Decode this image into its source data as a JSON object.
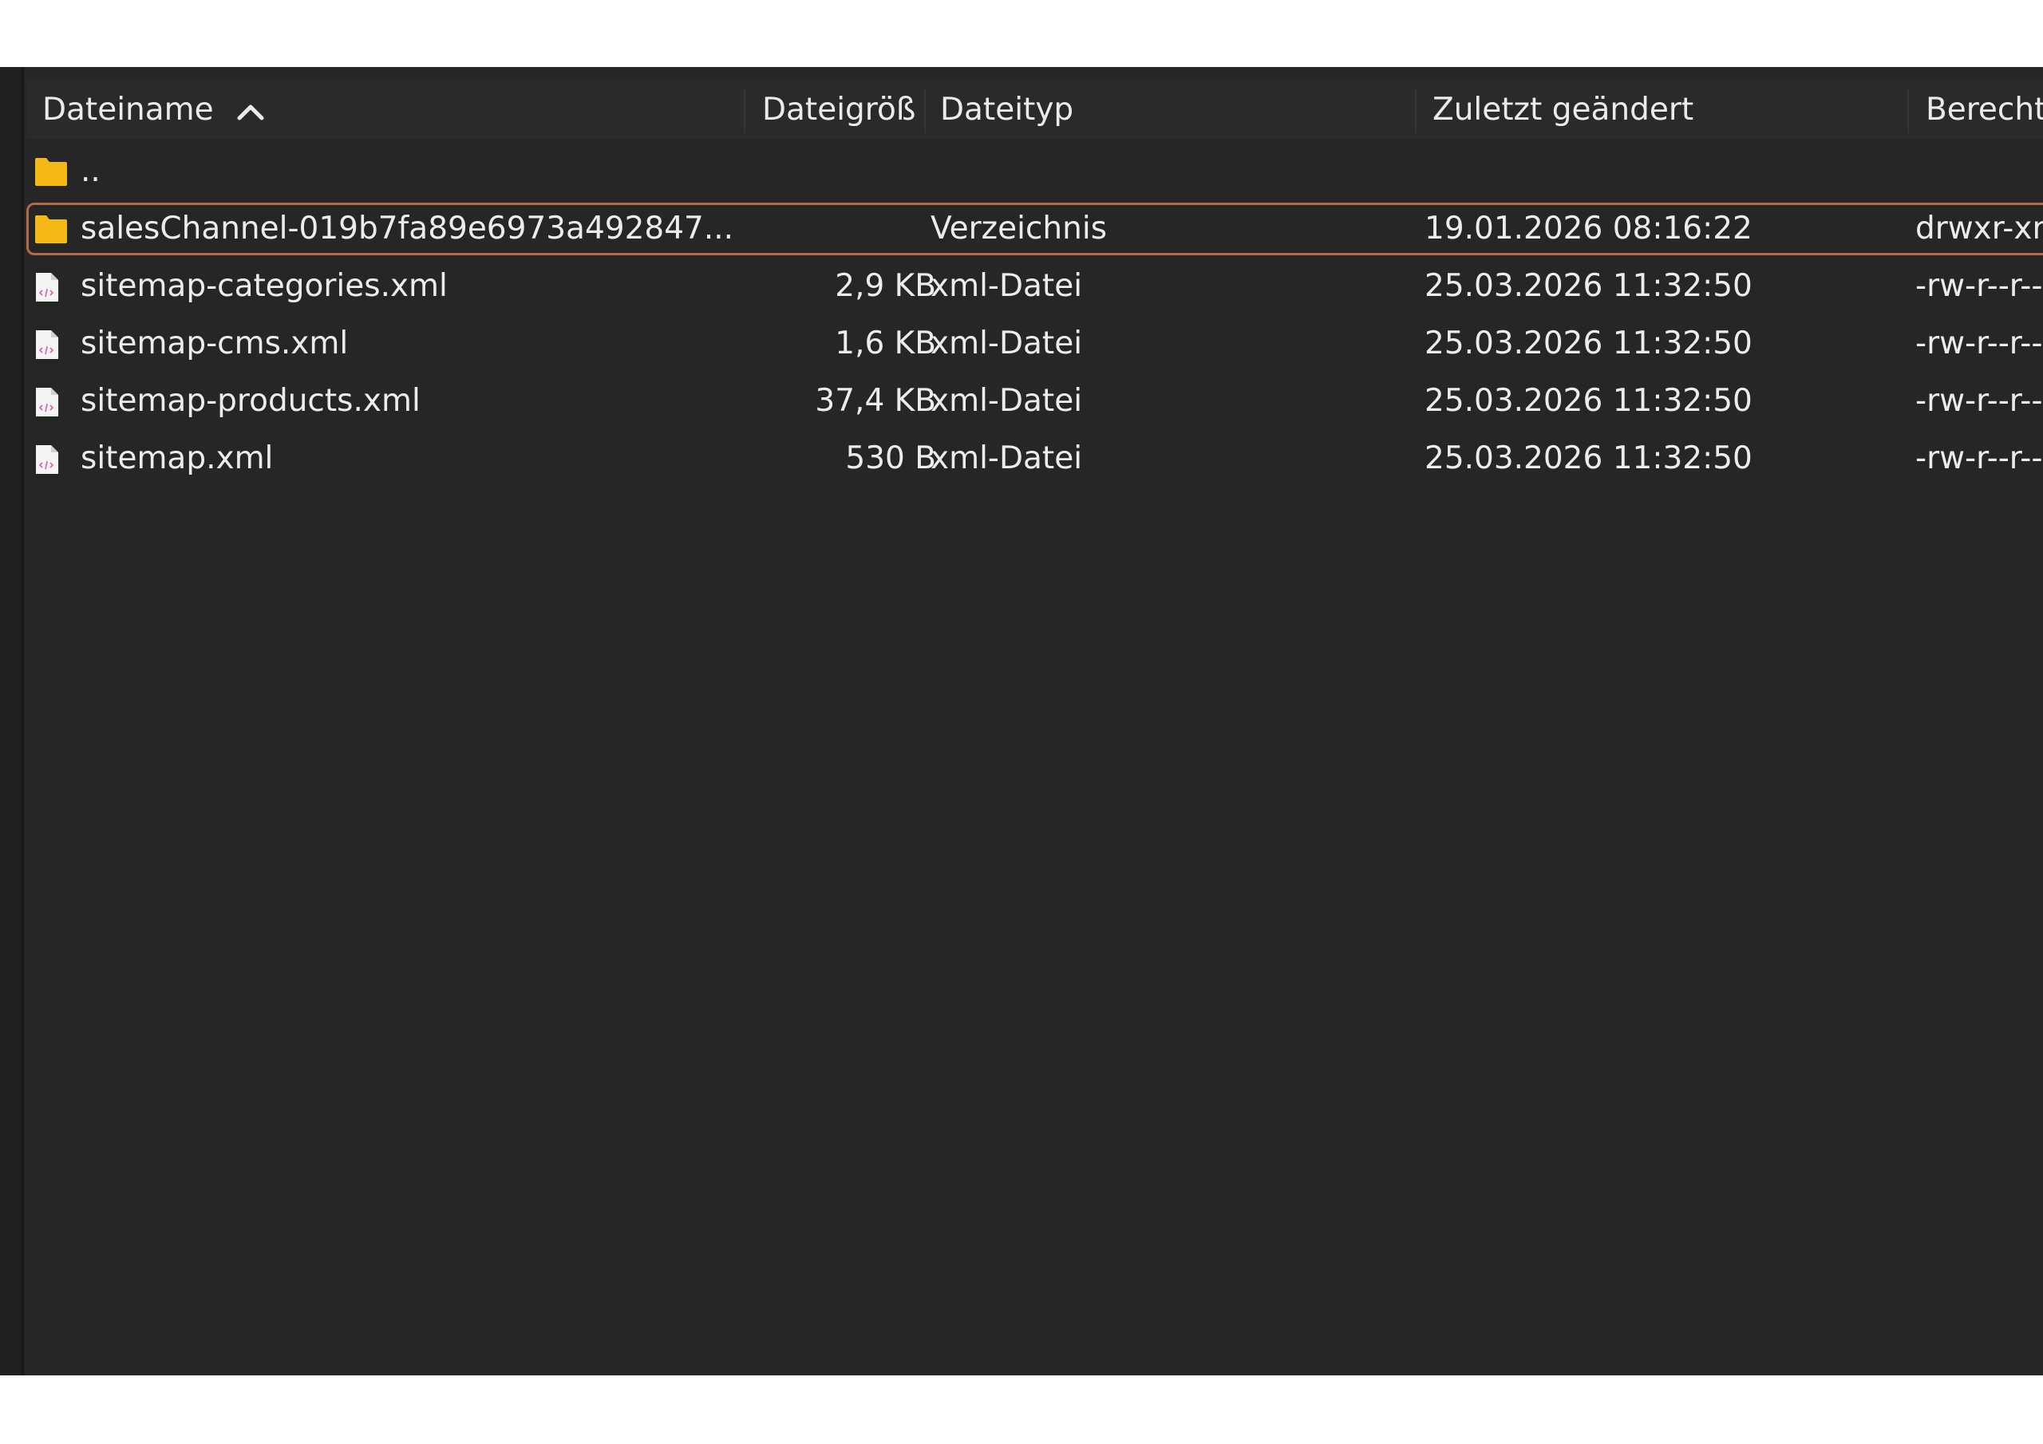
{
  "columns": {
    "name": "Dateiname",
    "size": "Dateigröß",
    "type": "Dateityp",
    "modified": "Zuletzt geändert",
    "permissions": "Berecht"
  },
  "sort": {
    "column": "name",
    "direction": "ascending",
    "icon": "chevron-up-icon"
  },
  "rows": [
    {
      "icon": "folder-icon",
      "name": "..",
      "size": "",
      "type": "",
      "modified": "",
      "permissions": ""
    },
    {
      "icon": "folder-icon",
      "name": "salesChannel-019b7fa89e6973a492847...",
      "size": "",
      "type": "Verzeichnis",
      "modified": "19.01.2026 08:16:22",
      "permissions": "drwxr-xr",
      "selected": true
    },
    {
      "icon": "xml-file-icon",
      "name": "sitemap-categories.xml",
      "size": "2,9 KB",
      "type": "xml-Datei",
      "modified": "25.03.2026 11:32:50",
      "permissions": "-rw-r--r--"
    },
    {
      "icon": "xml-file-icon",
      "name": "sitemap-cms.xml",
      "size": "1,6 KB",
      "type": "xml-Datei",
      "modified": "25.03.2026 11:32:50",
      "permissions": "-rw-r--r--"
    },
    {
      "icon": "xml-file-icon",
      "name": "sitemap-products.xml",
      "size": "37,4 KB",
      "type": "xml-Datei",
      "modified": "25.03.2026 11:32:50",
      "permissions": "-rw-r--r--"
    },
    {
      "icon": "xml-file-icon",
      "name": "sitemap.xml",
      "size": "530 B",
      "type": "xml-Datei",
      "modified": "25.03.2026 11:32:50",
      "permissions": "-rw-r--r--"
    }
  ],
  "colors": {
    "background": "#262626",
    "header": "#2a2a2a",
    "text": "#ececec",
    "selection_border": "#b5674a",
    "folder": "#f5b915"
  }
}
